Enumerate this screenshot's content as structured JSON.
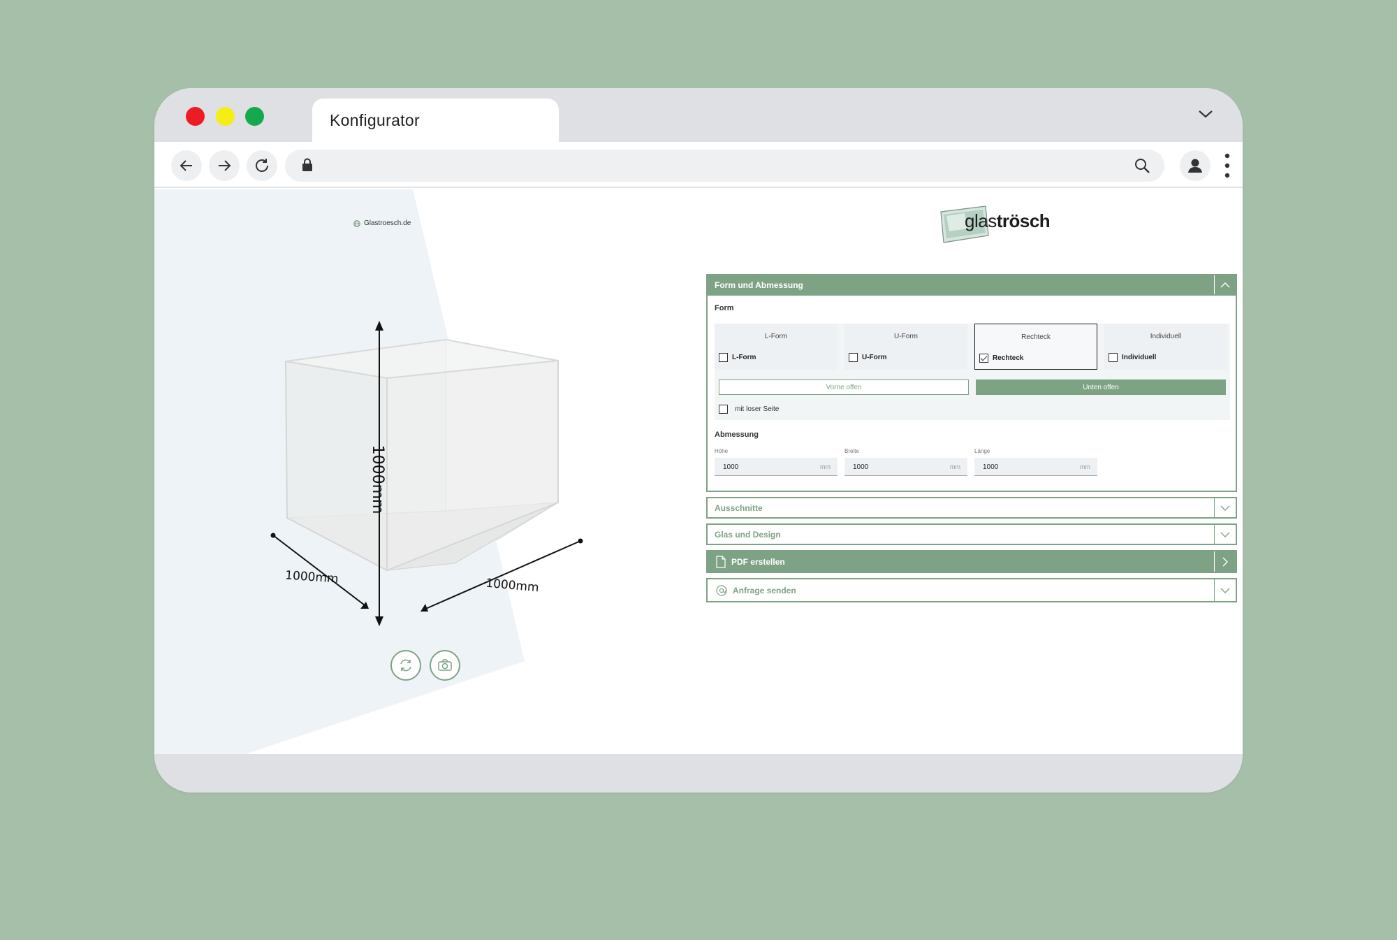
{
  "browser": {
    "tab_title": "Konfigurator",
    "url": ""
  },
  "viewer": {
    "site_link": "Glastroesch.de",
    "dim_height": "1000mm",
    "dim_depth": "1000mm",
    "dim_width": "1000mm"
  },
  "logo": {
    "part1": "glas",
    "part2": "trösch"
  },
  "panel": {
    "section_form_title": "Form und Abmessung",
    "form_label": "Form",
    "shapes": [
      {
        "caption": "L-Form",
        "check_label": "L-Form",
        "checked": false
      },
      {
        "caption": "U-Form",
        "check_label": "U-Form",
        "checked": false
      },
      {
        "caption": "Rechteck",
        "check_label": "Rechteck",
        "checked": true
      },
      {
        "caption": "Individuell",
        "check_label": "Individuell",
        "checked": false
      }
    ],
    "option_front": "Vorne offen",
    "option_bottom": "Unten offen",
    "loose_side_label": "mit loser Seite",
    "dimension_label": "Abmessung",
    "fields": [
      {
        "label": "Höhe",
        "value": "1000",
        "unit": "mm"
      },
      {
        "label": "Breite",
        "value": "1000",
        "unit": "mm"
      },
      {
        "label": "Länge",
        "value": "1000",
        "unit": "mm"
      }
    ],
    "section_cutouts": "Ausschnitte",
    "section_glass": "Glas und Design",
    "section_pdf": "PDF erstellen",
    "section_request": "Anfrage senden"
  },
  "colors": {
    "accent": "#7ea384",
    "background": "#a5bfa9",
    "chrome": "#dfe0e3"
  }
}
